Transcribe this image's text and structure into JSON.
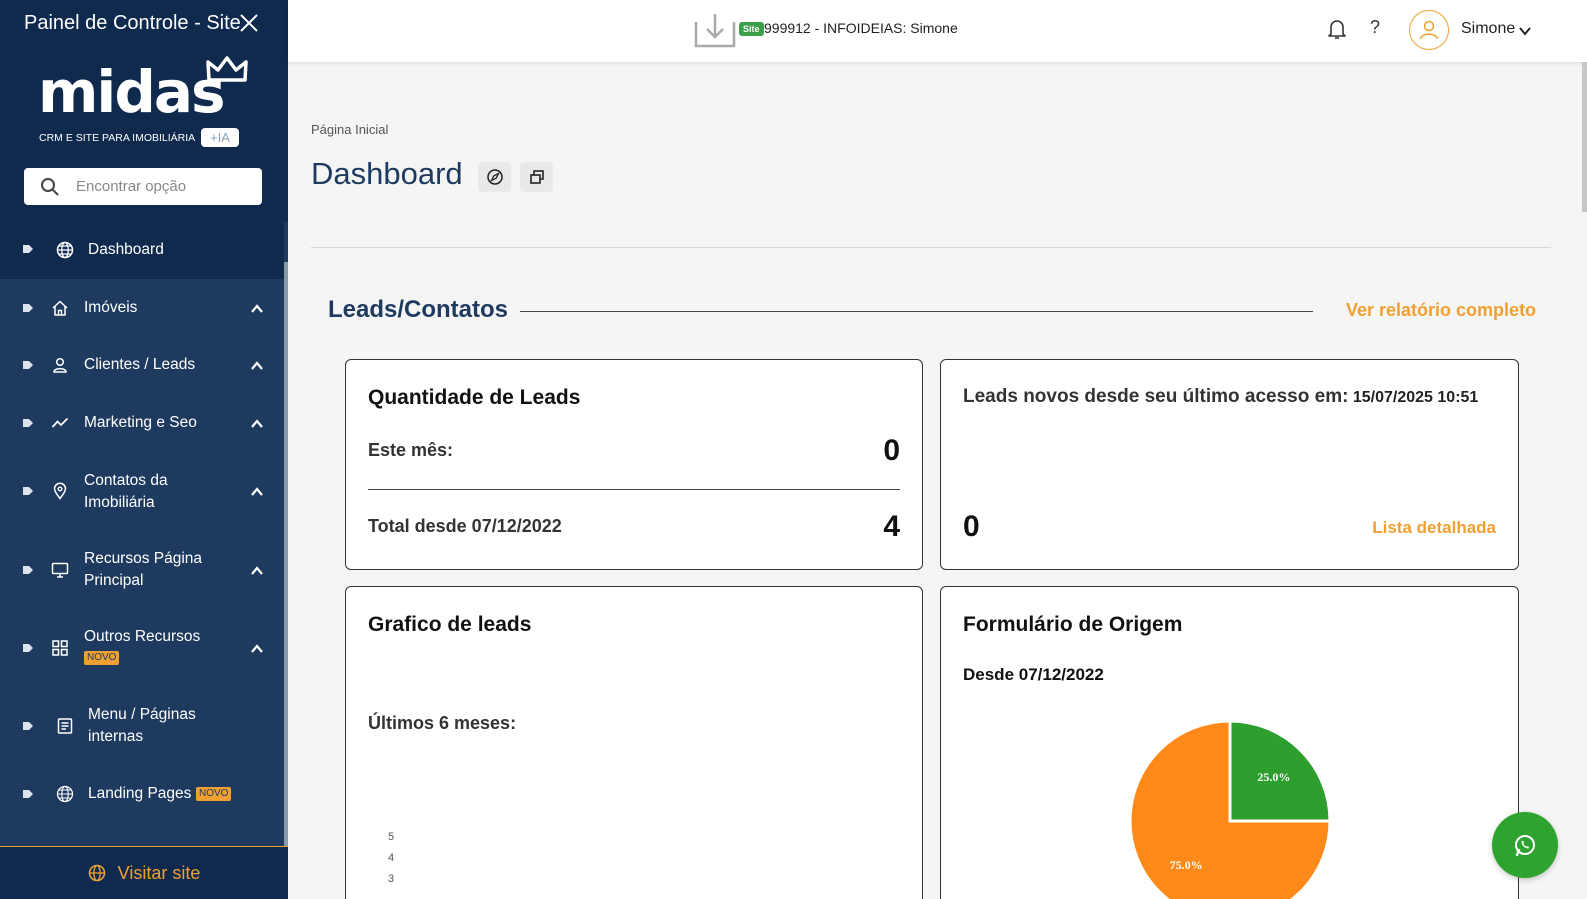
{
  "sidebar": {
    "title": "Painel de Controle - Site",
    "logo": {
      "word": "midas",
      "subtitle": "CRM E SITE PARA IMOBILIÁRIA",
      "badge": "+IA"
    },
    "search_placeholder": "Encontrar opção",
    "items": [
      {
        "label": "Dashboard",
        "icon": "globe-icon",
        "expandable": false,
        "active": true
      },
      {
        "label": "Imóveis",
        "icon": "home-icon",
        "expandable": true
      },
      {
        "label": "Clientes / Leads",
        "icon": "user-icon",
        "expandable": true
      },
      {
        "label": "Marketing e Seo",
        "icon": "trend-icon",
        "expandable": true
      },
      {
        "label": "Contatos da Imobiliária",
        "icon": "location-pin-icon",
        "expandable": true
      },
      {
        "label": "Recursos Página Principal",
        "icon": "monitor-icon",
        "expandable": true
      },
      {
        "label": "Outros Recursos",
        "icon": "grid-icon",
        "expandable": true,
        "badge": "NOVO"
      },
      {
        "label": "Menu / Páginas internas",
        "icon": "document-icon",
        "expandable": false
      },
      {
        "label": "Landing Pages",
        "icon": "globe-grid-icon",
        "expandable": false,
        "badge": "NOVO"
      }
    ],
    "visit_site": "Visitar site"
  },
  "topbar": {
    "site_badge": "Site",
    "site_text": "999912 - INFOIDEIAS: Simone",
    "help": "?",
    "user_name": "Simone"
  },
  "page": {
    "breadcrumb": "Página Inicial",
    "title": "Dashboard"
  },
  "leads": {
    "section_title": "Leads/Contatos",
    "report_link": "Ver relatório completo",
    "quantity_card": {
      "title": "Quantidade de Leads",
      "month_label": "Este mês:",
      "month_value": "0",
      "total_label": "Total desde 07/12/2022",
      "total_value": "4"
    },
    "new_card": {
      "title": "Leads novos desde seu último acesso em:",
      "date": "15/07/2025 10:51",
      "value": "0",
      "link": "Lista detalhada"
    },
    "chart_card": {
      "title": "Grafico de leads",
      "subtitle": "Últimos 6 meses:"
    },
    "origin_card": {
      "title": "Formulário de Origem",
      "since": "Desde 07/12/2022"
    }
  },
  "colors": {
    "sidebar": "#1e3a5f",
    "sidebar_dark": "#0f2a4d",
    "accent": "#f0a030",
    "green": "#2e9e2e",
    "orange": "#ff8a1a"
  },
  "chart_data": [
    {
      "type": "bar",
      "title": "Grafico de leads",
      "subtitle": "Últimos 6 meses:",
      "y_ticks": [
        "5",
        "4",
        "3"
      ],
      "categories": [],
      "values": []
    },
    {
      "type": "pie",
      "title": "Formulário de Origem",
      "subtitle": "Desde 07/12/2022",
      "slices": [
        {
          "percent": 25.0,
          "label": "25.0%",
          "color": "#2e9e2e"
        },
        {
          "percent": 75.0,
          "label": "75.0%",
          "color": "#ff8a1a"
        }
      ]
    }
  ]
}
